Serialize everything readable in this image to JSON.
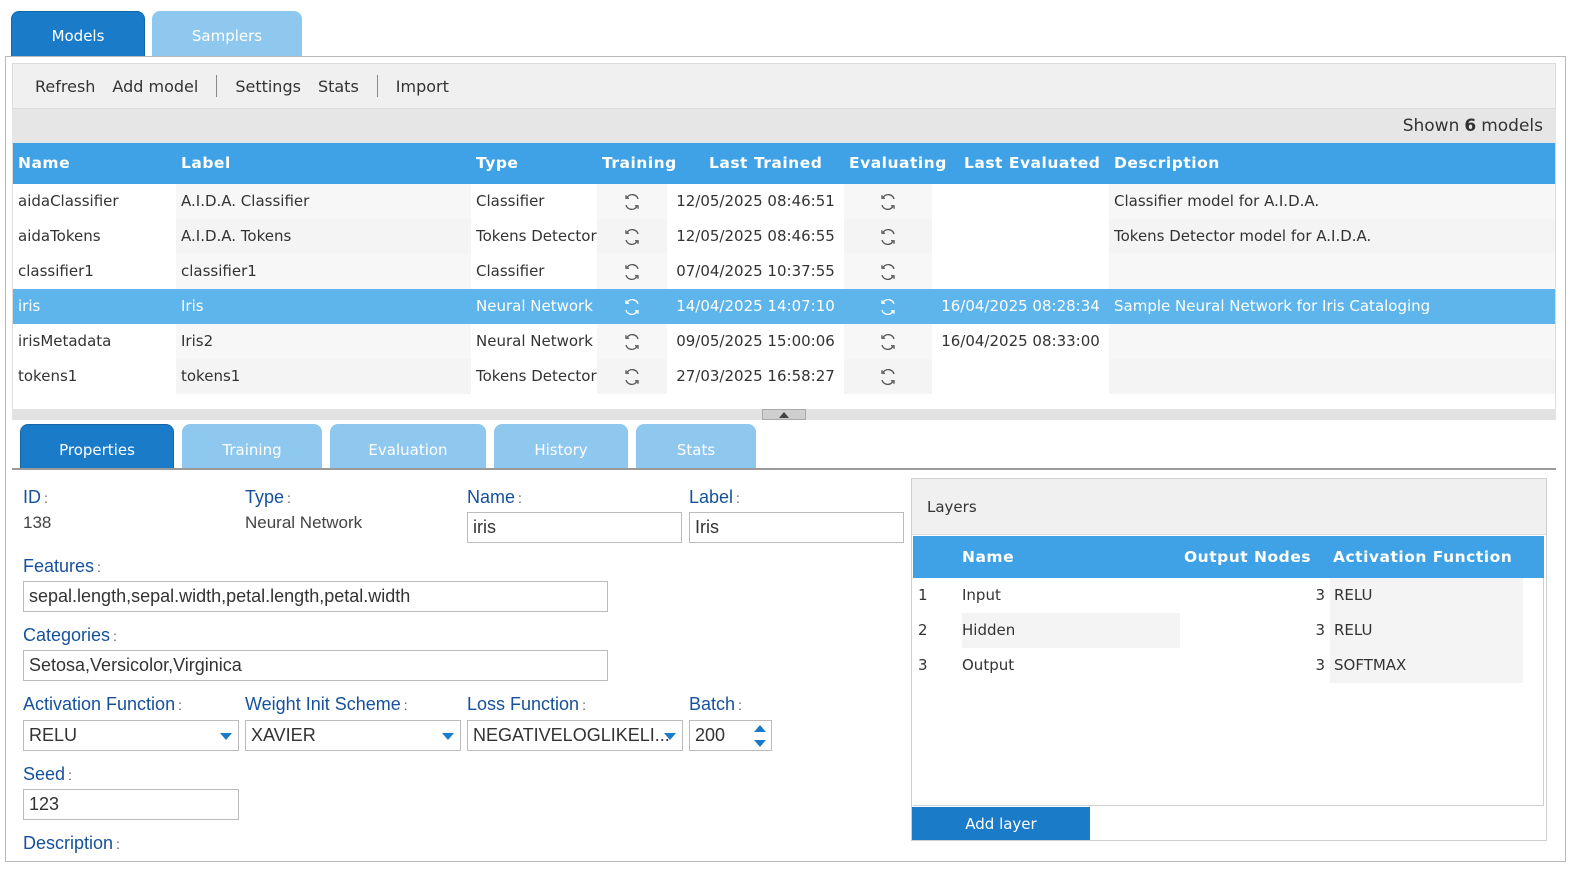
{
  "top_tabs": [
    {
      "label": "Models",
      "active": true
    },
    {
      "label": "Samplers",
      "active": false
    }
  ],
  "toolbar": {
    "refresh": "Refresh",
    "add_model": "Add model",
    "settings": "Settings",
    "stats": "Stats",
    "import": "Import"
  },
  "shown": {
    "prefix": "Shown",
    "count": "6",
    "suffix": "models"
  },
  "models_table": {
    "columns": [
      "Name",
      "Label",
      "Type",
      "Training",
      "Last Trained",
      "Evaluating",
      "Last Evaluated",
      "Description"
    ],
    "rows": [
      {
        "name": "aidaClassifier",
        "label": "A.I.D.A. Classifier",
        "type": "Classifier",
        "last_trained": "12/05/2025 08:46:51",
        "last_evaluated": "",
        "description": "Classifier model for A.I.D.A."
      },
      {
        "name": "aidaTokens",
        "label": "A.I.D.A. Tokens",
        "type": "Tokens Detector",
        "last_trained": "12/05/2025 08:46:55",
        "last_evaluated": "",
        "description": "Tokens Detector model for A.I.D.A."
      },
      {
        "name": "classifier1",
        "label": "classifier1",
        "type": "Classifier",
        "last_trained": "07/04/2025 10:37:55",
        "last_evaluated": "",
        "description": ""
      },
      {
        "name": "iris",
        "label": "Iris",
        "type": "Neural Network",
        "last_trained": "14/04/2025 14:07:10",
        "last_evaluated": "16/04/2025 08:28:34",
        "description": "Sample Neural Network for Iris Cataloging"
      },
      {
        "name": "irisMetadata",
        "label": "Iris2",
        "type": "Neural Network",
        "last_trained": "09/05/2025 15:00:06",
        "last_evaluated": "16/04/2025 08:33:00",
        "description": ""
      },
      {
        "name": "tokens1",
        "label": "tokens1",
        "type": "Tokens Detector",
        "last_trained": "27/03/2025 16:58:27",
        "last_evaluated": "",
        "description": ""
      }
    ],
    "selected_row": 3,
    "icons": {
      "training": "sync-icon",
      "evaluating": "sync-icon"
    }
  },
  "bottom_tabs": [
    {
      "label": "Properties",
      "active": true
    },
    {
      "label": "Training",
      "active": false
    },
    {
      "label": "Evaluation",
      "active": false
    },
    {
      "label": "History",
      "active": false
    },
    {
      "label": "Stats",
      "active": false
    }
  ],
  "properties": {
    "id_label": "ID",
    "id_value": "138",
    "type_label": "Type",
    "type_value": "Neural Network",
    "name_label": "Name",
    "name_value": "iris",
    "label_label": "Label",
    "label_value": "Iris",
    "features_label": "Features",
    "features_value": "sepal.length,sepal.width,petal.length,petal.width",
    "categories_label": "Categories",
    "categories_value": "Setosa,Versicolor,Virginica",
    "activation_label": "Activation Function",
    "activation_value": "RELU",
    "weight_label": "Weight Init Scheme",
    "weight_value": "XAVIER",
    "loss_label": "Loss Function",
    "loss_value": "NEGATIVELOGLIKELI...",
    "batch_label": "Batch",
    "batch_value": "200",
    "seed_label": "Seed",
    "seed_value": "123",
    "description_label": "Description",
    "colon": ":"
  },
  "layers": {
    "title": "Layers",
    "columns": [
      "Name",
      "Output Nodes",
      "Activation Function"
    ],
    "rows": [
      {
        "index": "1",
        "name": "Input",
        "output_nodes": "3",
        "activation": "RELU"
      },
      {
        "index": "2",
        "name": "Hidden",
        "output_nodes": "3",
        "activation": "RELU"
      },
      {
        "index": "3",
        "name": "Output",
        "output_nodes": "3",
        "activation": "SOFTMAX"
      }
    ],
    "add_button": "Add layer"
  },
  "colors": {
    "accent": "#1a7bc9",
    "header_blue": "#3fa2e6",
    "selected_row": "#5db5ec",
    "inactive_tab": "#8fc8ef",
    "label_blue": "#16519c"
  }
}
